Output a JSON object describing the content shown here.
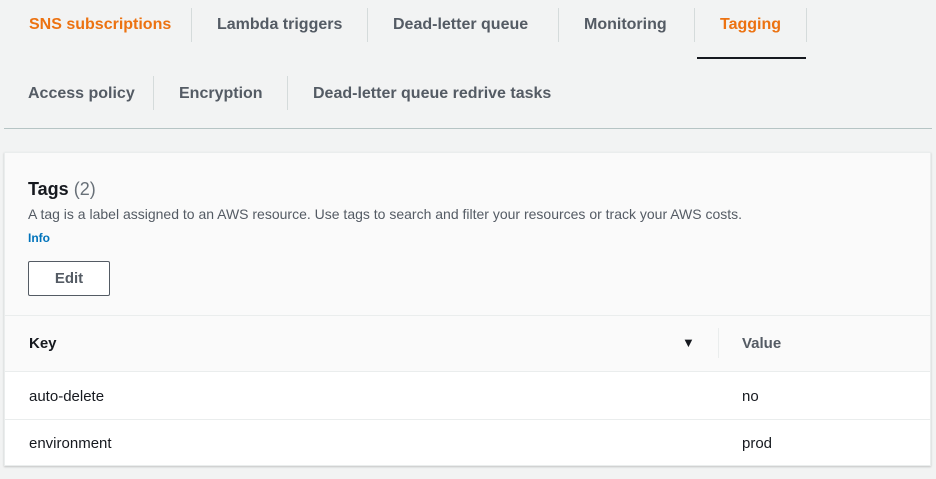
{
  "tabs_row1": [
    "SNS subscriptions",
    "Lambda triggers",
    "Dead-letter queue",
    "Monitoring",
    "Tagging"
  ],
  "tabs_row2": [
    "Access policy",
    "Encryption",
    "Dead-letter queue redrive tasks"
  ],
  "active_tab": "Tagging",
  "tags_panel": {
    "title": "Tags",
    "count": "(2)",
    "description": "A tag is a label assigned to an AWS resource. Use tags to search and filter your resources or track your AWS costs.",
    "info_link": "Info",
    "edit_label": "Edit",
    "columns": {
      "key": "Key",
      "value": "Value"
    },
    "rows": [
      {
        "key": "auto-delete",
        "value": "no"
      },
      {
        "key": "environment",
        "value": "prod"
      }
    ]
  },
  "colors": {
    "accent": "#ec7211",
    "link": "#0073bb"
  }
}
